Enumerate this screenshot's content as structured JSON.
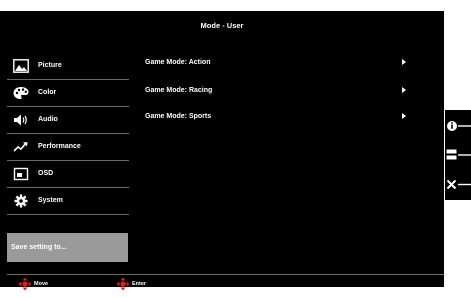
{
  "osd": {
    "title": "Mode - User"
  },
  "sidebar": {
    "items": [
      {
        "label": "Picture",
        "icon": "picture-icon"
      },
      {
        "label": "Color",
        "icon": "palette-icon"
      },
      {
        "label": "Audio",
        "icon": "speaker-icon"
      },
      {
        "label": "Performance",
        "icon": "performance-icon"
      },
      {
        "label": "OSD",
        "icon": "osd-icon"
      },
      {
        "label": "System",
        "icon": "gear-icon"
      }
    ],
    "save_label": "Save setting to..."
  },
  "menu": {
    "items": [
      {
        "label": "Game Mode: Action"
      },
      {
        "label": "Game Mode: Racing"
      },
      {
        "label": "Game Mode: Sports"
      }
    ]
  },
  "footer": {
    "move_label": "Move",
    "enter_label": "Enter"
  },
  "keys": [
    {
      "icon": "info-icon"
    },
    {
      "icon": "input-select-icon"
    },
    {
      "icon": "close-icon"
    }
  ],
  "colors": {
    "background": "#000000",
    "save_highlight": "#9a9a9a",
    "joystick_accent": "#e0201e"
  }
}
